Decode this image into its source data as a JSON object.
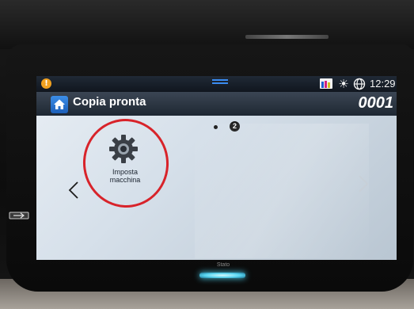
{
  "status_bar": {
    "time": "12:29",
    "alert_icon": "alert-icon",
    "toner_icon": "toner-level-icon",
    "brightness_icon": "sun-icon",
    "language_icon": "globe-icon"
  },
  "header": {
    "title": "Copia pronta",
    "copy_count": "0001",
    "home_icon": "home-icon"
  },
  "pagination": {
    "current_page": "2"
  },
  "apps": [
    {
      "label_line1": "Imposta",
      "label_line2": "macchina",
      "icon": "gear-icon"
    }
  ],
  "device": {
    "status_label": "Stato"
  },
  "colors": {
    "highlight": "#d8232a",
    "accent": "#3c8ee8",
    "led": "#58d4f0"
  }
}
